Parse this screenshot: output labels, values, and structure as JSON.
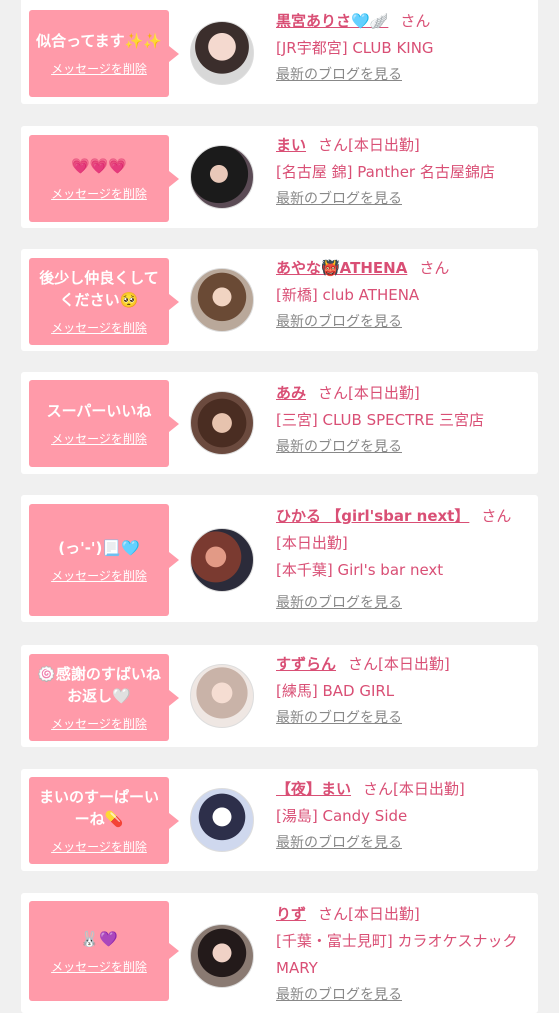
{
  "delete_label": "メッセージを削除",
  "blog_label": "最新のブログを見る",
  "san": "さん",
  "colors": {
    "bubble": "#ff9aa9",
    "accent": "#d94f75",
    "link_gray": "#888888",
    "background": "#f0f0f0"
  },
  "entries": [
    {
      "message": "似合ってます✨✨",
      "name": "黒宮ありさ🩵🪽",
      "status": "",
      "store": "[JR宇都宮] CLUB KING"
    },
    {
      "message": "💗💗💗",
      "name": "まい",
      "status": "[本日出勤]",
      "store": "[名古屋 錦] Panther 名古屋錦店"
    },
    {
      "message": "後少し仲良くしてください🥺",
      "name": "あやな👹ATHENA",
      "status": "",
      "store": "[新橋] club ATHENA"
    },
    {
      "message": "スーパーいいね",
      "name": "あみ",
      "status": "[本日出勤]",
      "store": "[三宮] CLUB SPECTRE 三宮店"
    },
    {
      "message": "(っ'-')📃🩵",
      "name": "ひかる 【girl'sbar next】",
      "status": "[本日出勤]",
      "store": "[本千葉] Girl's bar next"
    },
    {
      "message": "🍥感謝のすばいねお返し🤍",
      "name": "すずらん",
      "status": "[本日出勤]",
      "store": "[練馬] BAD GIRL"
    },
    {
      "message": "まいのすーぱーいーね💊",
      "name": "【夜】まい",
      "status": "[本日出勤]",
      "store": "[湯島] Candy Side"
    },
    {
      "message": "🐰💜",
      "name": "りず",
      "status": "[本日出勤]",
      "store": "[千葉・富士見町] カラオケスナック MARY"
    }
  ]
}
